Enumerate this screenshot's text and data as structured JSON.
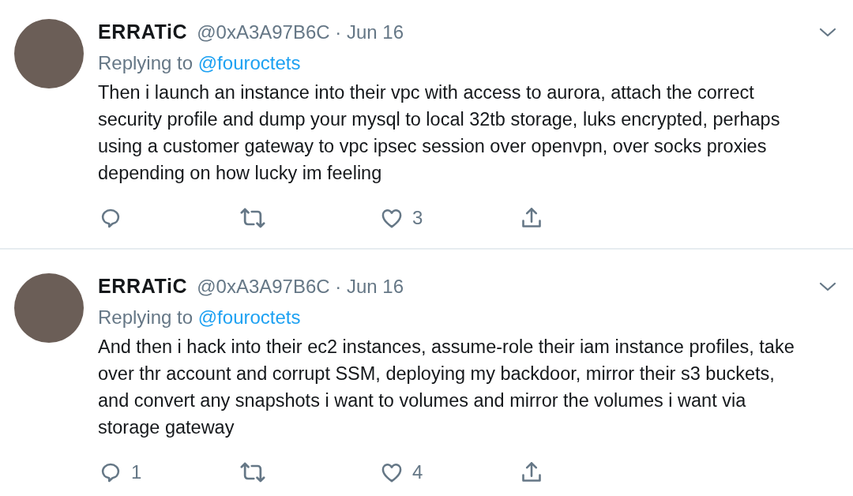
{
  "tweets": [
    {
      "name": "ERRATiC",
      "meta": "@0xA3A97B6C · Jun 16",
      "replying_label": "Replying to",
      "reply_to": "@fouroctets",
      "text": "Then i launch an instance into their vpc with access to aurora, attach the correct security profile and dump your mysql to local 32tb storage, luks encrypted, perhaps using a customer gateway to vpc ipsec session over openvpn, over socks proxies depending on how lucky im feeling",
      "like_count": "3"
    },
    {
      "name": "ERRATiC",
      "meta": "@0xA3A97B6C · Jun 16",
      "replying_label": "Replying to",
      "reply_to": "@fouroctets",
      "text": "And then i hack into their ec2 instances, assume-role their iam instance profiles, take over thr account and corrupt SSM, deploying my backdoor, mirror their s3 buckets, and convert any snapshots i want to volumes and mirror the volumes i want via storage gateway",
      "reply_count": "1",
      "like_count": "4"
    }
  ]
}
